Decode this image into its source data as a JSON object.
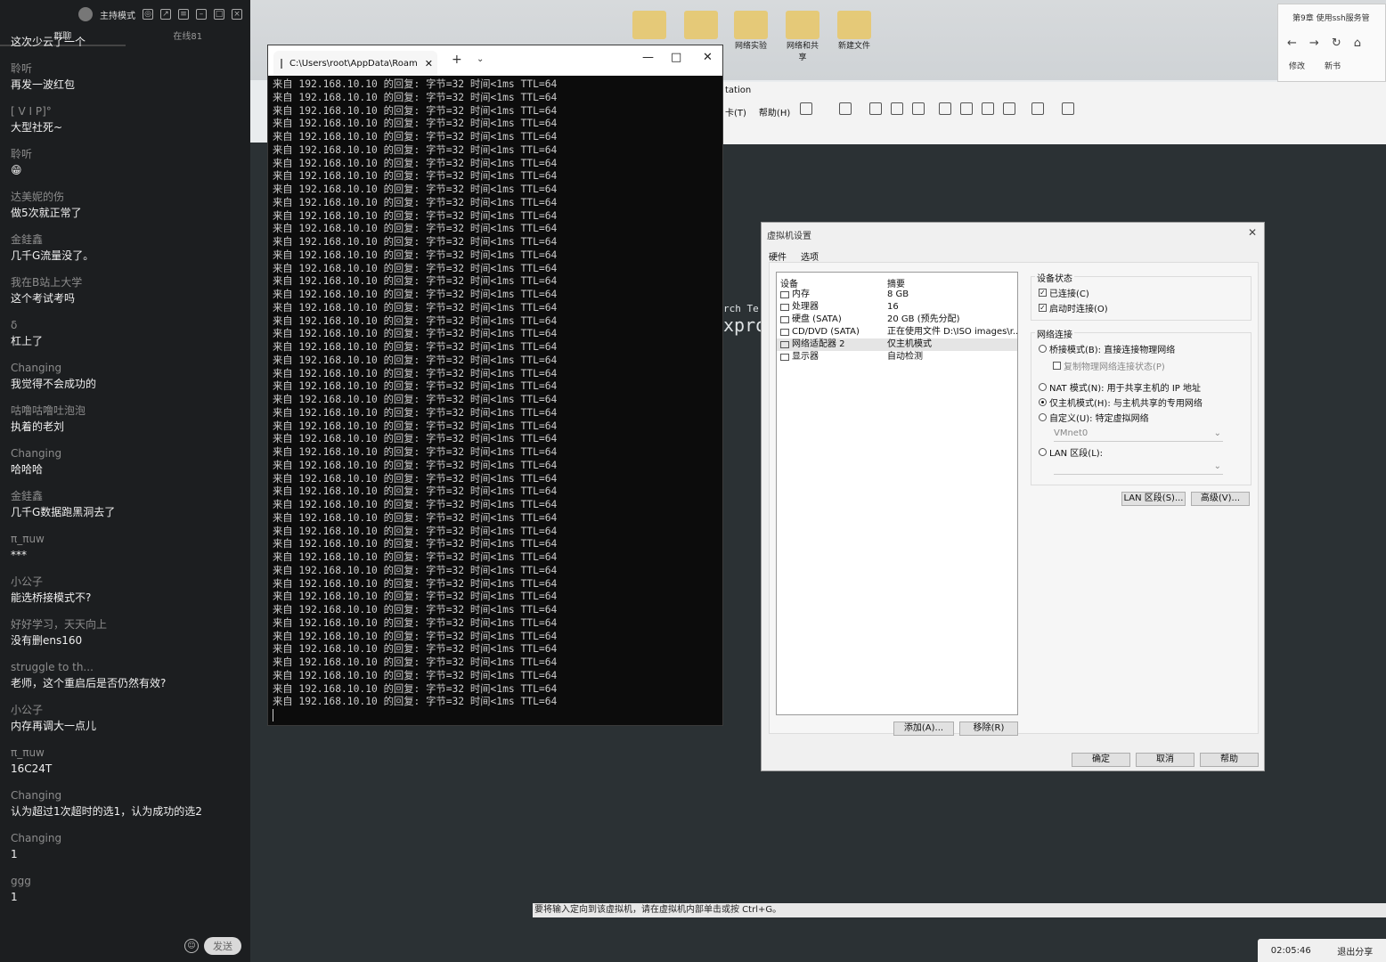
{
  "chat": {
    "header_title": "主持模式",
    "tabs": [
      "群聊",
      "在线81"
    ],
    "messages": [
      {
        "nick": "",
        "text": "这次少云了一个"
      },
      {
        "nick": "聆听",
        "text": "再发一波红包"
      },
      {
        "nick": "[    V     I      P]°",
        "text": "大型社死~"
      },
      {
        "nick": "聆听",
        "text": "😁"
      },
      {
        "nick": "达美妮的伤",
        "text": "做5次就正常了"
      },
      {
        "nick": "金銈鑫",
        "text": "几千G流量没了。"
      },
      {
        "nick": "我在B站上大学",
        "text": "这个考试考吗"
      },
      {
        "nick": "δ",
        "text": "杠上了"
      },
      {
        "nick": "Changing",
        "text": "我觉得不会成功的"
      },
      {
        "nick": "咕噜咕噜吐泡泡",
        "text": "执着的老刘"
      },
      {
        "nick": "Changing",
        "text": "哈哈哈"
      },
      {
        "nick": "金銈鑫",
        "text": "几千G数据跑黑洞去了"
      },
      {
        "nick": "π_πuw",
        "text": "***"
      },
      {
        "nick": "小公子",
        "text": "能选桥接模式不?"
      },
      {
        "nick": "好好学习，天天向上",
        "text": "没有删ens160"
      },
      {
        "nick": "struggle to th...",
        "text": "老师，这个重启后是否仍然有效?"
      },
      {
        "nick": "小公子",
        "text": "内存再调大一点儿"
      },
      {
        "nick": "π_πuw",
        "text": "16C24T"
      },
      {
        "nick": "Changing",
        "text": "认为超过1次超时的选1，认为成功的选2"
      },
      {
        "nick": "Changing",
        "text": "1"
      },
      {
        "nick": "ggg",
        "text": "1"
      }
    ],
    "send_label": "发送"
  },
  "desktop": {
    "icons": [
      "",
      "",
      "网络实验",
      "网络和共享",
      "新建文件"
    ]
  },
  "browser": {
    "tab_title": "第9章 使用ssh服务管",
    "links": [
      "修改",
      "新书"
    ]
  },
  "vmware": {
    "title_fragment": "tation",
    "menu": [
      "卡(T)",
      "帮助(H)"
    ],
    "console_small": "rch   Te",
    "console_big": "xpro",
    "status_text": "要将输入定向到该虚拟机，请在虚拟机内部单击或按 Ctrl+G。"
  },
  "terminal": {
    "tab_title": "C:\\Users\\root\\AppData\\Roam",
    "line": "来自 192.168.10.10 的回复: 字节=32 时间<1ms TTL=64",
    "line_count": 48
  },
  "dialog": {
    "title": "虚拟机设置",
    "tabs": [
      "硬件",
      "选项"
    ],
    "col_device": "设备",
    "col_summary": "摘要",
    "devices": [
      {
        "icon": "memory-icon",
        "name": "内存",
        "summary": "8 GB"
      },
      {
        "icon": "cpu-icon",
        "name": "处理器",
        "summary": "16"
      },
      {
        "icon": "disk-icon",
        "name": "硬盘 (SATA)",
        "summary": "20 GB (预先分配)"
      },
      {
        "icon": "cd-icon",
        "name": "CD/DVD (SATA)",
        "summary": "正在使用文件 D:\\ISO images\\r..."
      },
      {
        "icon": "network-icon",
        "name": "网络适配器 2",
        "summary": "仅主机模式"
      },
      {
        "icon": "display-icon",
        "name": "显示器",
        "summary": "自动检测"
      }
    ],
    "selected_index": 4,
    "device_status": {
      "legend": "设备状态",
      "connected": "已连接(C)",
      "connect_on_start": "启动时连接(O)"
    },
    "network": {
      "legend": "网络连接",
      "bridged": "桥接模式(B): 直接连接物理网络",
      "replicate": "复制物理网络连接状态(P)",
      "nat": "NAT 模式(N): 用于共享主机的 IP 地址",
      "hostonly": "仅主机模式(H): 与主机共享的专用网络",
      "custom": "自定义(U): 特定虚拟网络",
      "custom_value": "VMnet0",
      "lan": "LAN 区段(L):",
      "selected": "hostonly"
    },
    "buttons": {
      "lan_segments": "LAN 区段(S)...",
      "advanced": "高级(V)...",
      "add": "添加(A)...",
      "remove": "移除(R)",
      "ok": "确定",
      "cancel": "取消",
      "help": "帮助"
    }
  },
  "taskbar": {
    "time": "02:05:46",
    "exit_share": "退出分享"
  }
}
